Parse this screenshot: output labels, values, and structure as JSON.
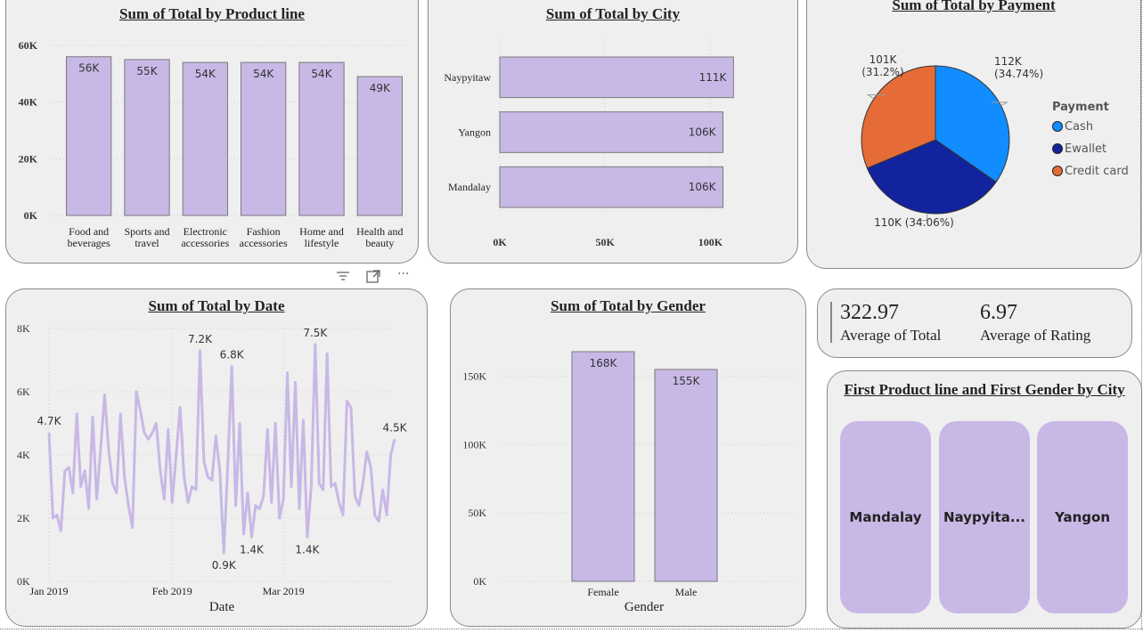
{
  "toolbar": {
    "filter_icon": "filter-icon",
    "focus_icon": "focus-mode-icon",
    "more_icon": "more-options-icon",
    "more_label": "···"
  },
  "colors": {
    "bar": "#c8b8e6",
    "bar_border": "#7a7a7a",
    "card_bg": "#efefef",
    "line": "#c8b8e6",
    "cash": "#118dff",
    "ewallet": "#12239e",
    "credit_card": "#e66c37"
  },
  "chart_data": [
    {
      "id": "product",
      "type": "bar",
      "title": "Sum of Total by Product line",
      "categories": [
        [
          "Food and",
          "beverages"
        ],
        [
          "Sports and",
          "travel"
        ],
        [
          "Electronic",
          "accessories"
        ],
        [
          "Fashion",
          "accessories"
        ],
        [
          "Home and",
          "lifestyle"
        ],
        [
          "Health and",
          "beauty"
        ]
      ],
      "values": [
        56000,
        55000,
        54000,
        54000,
        54000,
        49000
      ],
      "data_labels": [
        "56K",
        "55K",
        "54K",
        "54K",
        "54K",
        "49K"
      ],
      "yticks": [
        0,
        20000,
        40000,
        60000
      ],
      "ytick_labels": [
        "0K",
        "20K",
        "40K",
        "60K"
      ],
      "ylim": [
        0,
        60000
      ],
      "grid": true
    },
    {
      "id": "city",
      "type": "bar",
      "orientation": "horizontal",
      "title": "Sum of Total by City",
      "categories": [
        "Naypyitaw",
        "Yangon",
        "Mandalay"
      ],
      "values": [
        111000,
        106000,
        106000
      ],
      "data_labels": [
        "111K",
        "106K",
        "106K"
      ],
      "xticks": [
        0,
        50000,
        100000
      ],
      "xtick_labels": [
        "0K",
        "50K",
        "100K"
      ],
      "xlim": [
        0,
        110000
      ],
      "grid": true
    },
    {
      "id": "payment",
      "type": "pie",
      "title": "Sum of Total by Payment",
      "legend_title": "Payment",
      "legend_position": "right",
      "slices": [
        {
          "name": "Cash",
          "value": 112000,
          "label": "112K",
          "pct": "(34.74%)",
          "color": "#118dff"
        },
        {
          "name": "Ewallet",
          "value": 110000,
          "label": "110K (34.06%)",
          "pct": "",
          "color": "#12239e"
        },
        {
          "name": "Credit card",
          "value": 101000,
          "label": "101K",
          "pct": "(31.2%)",
          "color": "#e66c37"
        }
      ]
    },
    {
      "id": "date",
      "type": "line",
      "title": "Sum of Total by Date",
      "xlabel": "Date",
      "ylim": [
        0,
        8000
      ],
      "yticks": [
        0,
        2000,
        4000,
        6000,
        8000
      ],
      "ytick_labels": [
        "0K",
        "2K",
        "4K",
        "6K",
        "8K"
      ],
      "xtick_labels": [
        {
          "label": "Jan 2019",
          "index": 0
        },
        {
          "label": "Feb 2019",
          "index": 31
        },
        {
          "label": "Mar 2019",
          "index": 59
        }
      ],
      "values": [
        4700,
        2000,
        2100,
        1600,
        3500,
        3600,
        2800,
        5300,
        3000,
        3500,
        2300,
        5200,
        2600,
        4200,
        5900,
        4200,
        3100,
        2800,
        5300,
        3300,
        2400,
        1700,
        6000,
        5400,
        4700,
        4500,
        4700,
        5000,
        3500,
        2600,
        4800,
        2500,
        4000,
        5500,
        3300,
        2500,
        3000,
        2900,
        7300,
        3800,
        3300,
        3200,
        4600,
        3500,
        900,
        3700,
        6800,
        2400,
        5000,
        1500,
        2800,
        1400,
        2400,
        2300,
        2700,
        4800,
        2500,
        5000,
        2000,
        2600,
        6600,
        3000,
        6300,
        2300,
        5100,
        1400,
        3000,
        7500,
        3100,
        2900,
        7200,
        3000,
        3100,
        2500,
        2100,
        5700,
        5500,
        2700,
        2400,
        3100,
        4100,
        3600,
        2100,
        1900,
        2900,
        2100,
        4000,
        4500
      ],
      "annotations": [
        {
          "index": 0,
          "text": "4.7K",
          "pos": "above"
        },
        {
          "index": 38,
          "text": "7.2K",
          "pos": "above"
        },
        {
          "index": 44,
          "text": "0.9K",
          "pos": "below"
        },
        {
          "index": 46,
          "text": "6.8K",
          "pos": "above"
        },
        {
          "index": 51,
          "text": "1.4K",
          "pos": "below"
        },
        {
          "index": 65,
          "text": "1.4K",
          "pos": "below"
        },
        {
          "index": 67,
          "text": "7.5K",
          "pos": "above"
        },
        {
          "index": 87,
          "text": "4.5K",
          "pos": "above"
        }
      ],
      "grid": true
    },
    {
      "id": "gender",
      "type": "bar",
      "title": "Sum of Total by Gender",
      "xlabel": "Gender",
      "categories": [
        "Female",
        "Male"
      ],
      "values": [
        168000,
        155000
      ],
      "data_labels": [
        "168K",
        "155K"
      ],
      "yticks": [
        0,
        50000,
        100000,
        150000
      ],
      "ytick_labels": [
        "0K",
        "50K",
        "100K",
        "150K"
      ],
      "ylim": [
        0,
        168000
      ],
      "grid": true
    }
  ],
  "kpi": {
    "avg_total_value": "322.97",
    "avg_total_label": "Average of Total",
    "avg_rating_value": "6.97",
    "avg_rating_label": "Average of Rating"
  },
  "multirow": {
    "title": "First Product line and First Gender by City",
    "cities": [
      "Mandalay",
      "Naypyita...",
      "Yangon"
    ]
  }
}
